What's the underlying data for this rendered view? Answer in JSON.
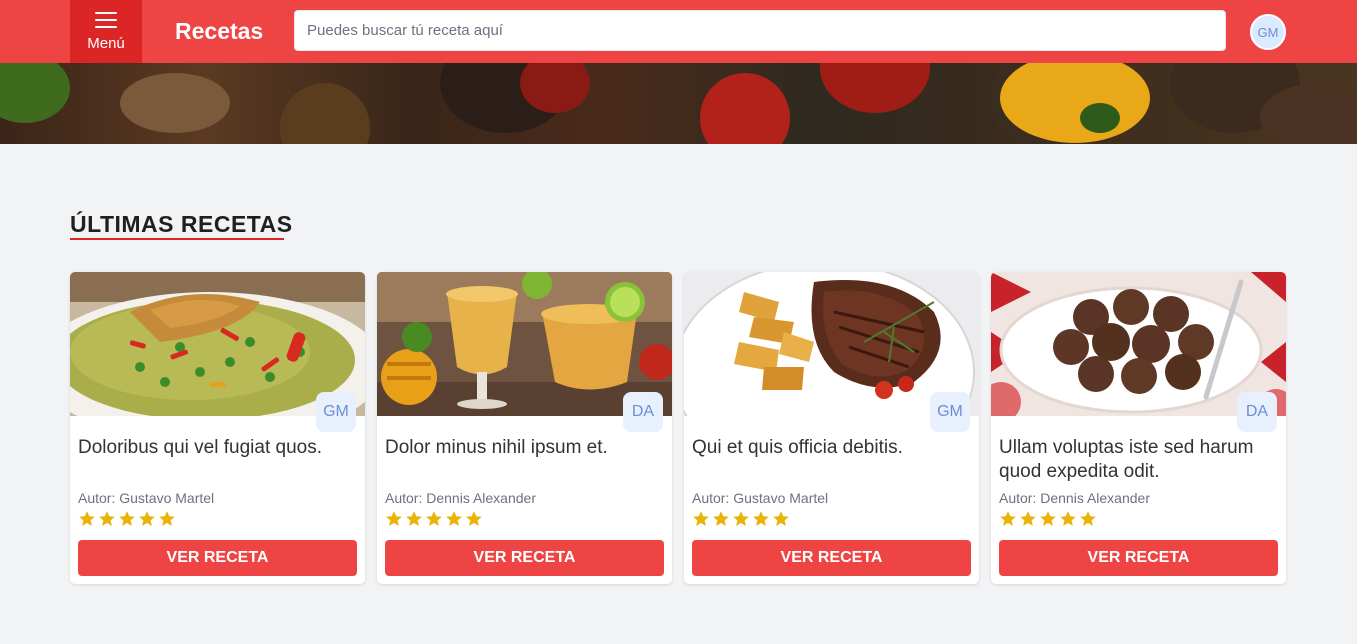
{
  "header": {
    "menu_label": "Menú",
    "brand": "Recetas",
    "search_placeholder": "Puedes buscar tú receta aquí",
    "user_initials": "GM"
  },
  "section": {
    "title": "ÚLTIMAS RECETAS"
  },
  "colors": {
    "accent": "#ef4444",
    "accent_dark": "#dc2626",
    "star": "#eab308",
    "badge_bg": "#e8f0fe",
    "badge_text": "#6b8fd6"
  },
  "rating_max": 5,
  "button_label": "VER RECETA",
  "recipes": [
    {
      "title": "Doloribus qui vel fugiat quos.",
      "author": "Autor: Gustavo Martel",
      "initials": "GM",
      "rating": 5,
      "image": "rice-with-chicken-image"
    },
    {
      "title": "Dolor minus nihil ipsum et.",
      "author": "Autor: Dennis Alexander",
      "initials": "DA",
      "rating": 5,
      "image": "mango-smoothie-image"
    },
    {
      "title": "Qui et quis officia debitis.",
      "author": "Autor: Gustavo Martel",
      "initials": "GM",
      "rating": 5,
      "image": "steak-potatoes-image"
    },
    {
      "title": "Ullam voluptas iste sed harum quod expedita odit.",
      "author": "Autor: Dennis Alexander",
      "initials": "DA",
      "rating": 5,
      "image": "chocolate-truffles-image"
    }
  ]
}
